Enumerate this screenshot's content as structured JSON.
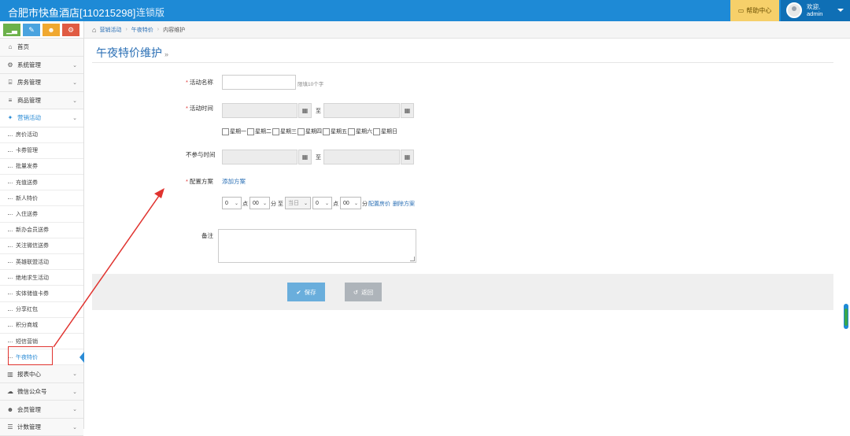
{
  "header": {
    "brand": "合肥市快鱼酒店[110215298]",
    "edition": "连锁版",
    "help_label": "帮助中心",
    "welcome": "欢迎,",
    "username": "admin"
  },
  "shortcuts": [
    {
      "icon": "chart-icon",
      "glyph": "▁▃",
      "color": "#6cb14a"
    },
    {
      "icon": "pencil-icon",
      "glyph": "✎",
      "color": "#4aa3df"
    },
    {
      "icon": "users-icon",
      "glyph": "☻",
      "color": "#f0a830"
    },
    {
      "icon": "cogs-icon",
      "glyph": "⚙",
      "color": "#e05b43"
    }
  ],
  "sidebar": {
    "items": [
      {
        "label": "首页",
        "icon": "home-icon",
        "glyph": "⌂",
        "chevron": false
      },
      {
        "label": "系统管理",
        "icon": "gear-icon",
        "glyph": "⚙",
        "chevron": true
      },
      {
        "label": "房务管理",
        "icon": "bank-icon",
        "glyph": "⌸",
        "chevron": true
      },
      {
        "label": "商品管理",
        "icon": "database-icon",
        "glyph": "≡",
        "chevron": true
      },
      {
        "label": "营销活动",
        "icon": "gift-icon",
        "glyph": "✦",
        "chevron": true,
        "active": true
      }
    ],
    "submenu": [
      "房价活动",
      "卡券管理",
      "批量发券",
      "充值送券",
      "新人特价",
      "入住送券",
      "新办会员送券",
      "关注微信送券",
      "英雄联盟活动",
      "绝地求生活动",
      "实体储值卡券",
      "分享红包",
      "积分商城",
      "短信营销",
      "午夜特价"
    ],
    "current_sub": "午夜特价",
    "bottom_items": [
      {
        "label": "报表中心",
        "icon": "bar-chart-icon",
        "glyph": "▥"
      },
      {
        "label": "微信公众号",
        "icon": "cloud-icon",
        "glyph": "☁"
      },
      {
        "label": "会员管理",
        "icon": "group-icon",
        "glyph": "☻"
      },
      {
        "label": "计数管理",
        "icon": "list-icon",
        "glyph": "☰"
      }
    ]
  },
  "breadcrumb": {
    "items": [
      "营销活动",
      "午夜特价",
      "内容维护"
    ]
  },
  "page": {
    "title": "午夜特价维护",
    "title_arrow": "»"
  },
  "form": {
    "name_label": "活动名称",
    "name_value": "",
    "name_hint": "限填10个字",
    "time_label": "活动时间",
    "to_label": "至",
    "weekdays": [
      "星期一",
      "星期二",
      "星期三",
      "星期四",
      "星期五",
      "星期六",
      "星期日"
    ],
    "exclude_label": "不参与时间",
    "plan_label": "配置方案",
    "add_plan_link": "添加方案",
    "plan_row": {
      "hour_start": "0",
      "hour_unit": "点",
      "min_start": "00",
      "min_unit": "分",
      "to": "至",
      "day_select": "当日",
      "hour_end": "0",
      "min_end": "00",
      "config_link": "配置房价",
      "delete_link": "删除方案"
    },
    "remark_label": "备注"
  },
  "actions": {
    "save_label": "保存",
    "back_label": "返回"
  },
  "colors": {
    "topbar": "#1e8ad6",
    "accent": "#2a8bd5",
    "highlight": "#e0332f",
    "save_btn": "#6aaedc",
    "back_btn": "#aeb4ba"
  }
}
